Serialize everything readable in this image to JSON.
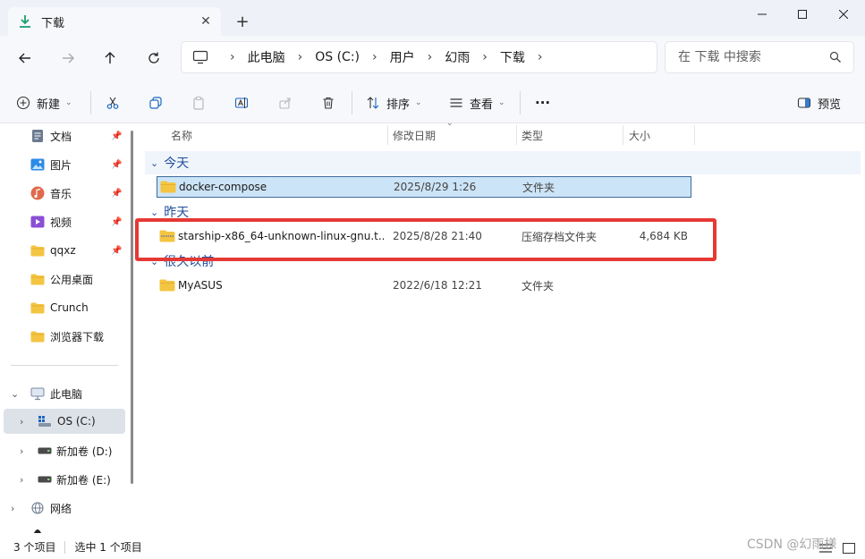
{
  "tab": {
    "title": "下载",
    "close": "✕",
    "new_tab": "+"
  },
  "window_controls": {
    "minimize": "—",
    "maximize": "☐",
    "close": "✕"
  },
  "breadcrumb": [
    "此电脑",
    "OS (C:)",
    "用户",
    "幻雨",
    "下载"
  ],
  "search": {
    "placeholder": "在 下载 中搜索"
  },
  "toolbar": {
    "new_label": "新建",
    "sort_label": "排序",
    "view_label": "查看",
    "more_label": "···",
    "preview_label": "预览"
  },
  "sidebar": {
    "quick_access": [
      {
        "label": "文档",
        "icon": "documents-icon",
        "pinned": true
      },
      {
        "label": "图片",
        "icon": "pictures-icon",
        "pinned": true
      },
      {
        "label": "音乐",
        "icon": "music-icon",
        "pinned": true
      },
      {
        "label": "视频",
        "icon": "videos-icon",
        "pinned": true
      },
      {
        "label": "qqxz",
        "icon": "folder-icon",
        "pinned": true
      },
      {
        "label": "公用桌面",
        "icon": "folder-icon",
        "pinned": false
      },
      {
        "label": "Crunch",
        "icon": "folder-icon",
        "pinned": false
      },
      {
        "label": "浏览器下载",
        "icon": "folder-icon",
        "pinned": false
      }
    ],
    "tree": [
      {
        "label": "此电脑",
        "icon": "this-pc-icon",
        "expanded": true
      },
      {
        "label": "OS (C:)",
        "icon": "drive-c-icon",
        "selected": true
      },
      {
        "label": "新加卷 (D:)",
        "icon": "drive-icon"
      },
      {
        "label": "新加卷 (E:)",
        "icon": "drive-icon"
      },
      {
        "label": "网络",
        "icon": "network-icon"
      }
    ]
  },
  "columns": {
    "name": "名称",
    "date": "修改日期",
    "type": "类型",
    "size": "大小"
  },
  "groups": [
    {
      "label": "今天",
      "files": [
        {
          "name": "docker-compose",
          "date": "2025/8/29 1:26",
          "type": "文件夹",
          "size": "",
          "icon": "folder-icon",
          "selected": true
        }
      ]
    },
    {
      "label": "昨天",
      "files": [
        {
          "name": "starship-x86_64-unknown-linux-gnu.t...",
          "date": "2025/8/28 21:40",
          "type": "压缩存档文件夹",
          "size": "4,684 KB",
          "icon": "zip-folder-icon",
          "selected": false
        }
      ]
    },
    {
      "label": "很久以前",
      "files": [
        {
          "name": "MyASUS",
          "date": "2022/6/18 12:21",
          "type": "文件夹",
          "size": "",
          "icon": "folder-icon",
          "selected": false
        }
      ]
    }
  ],
  "status": {
    "item_count": "3 个项目",
    "selection": "选中 1 个项目"
  },
  "watermark": "CSDN @幻雨様",
  "colors": {
    "accent": "#1f4e9a",
    "selection": "#cce4f7",
    "highlight": "#e53935",
    "folder": "#f4c542"
  }
}
